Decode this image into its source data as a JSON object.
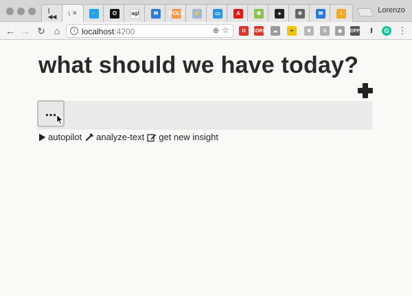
{
  "browser": {
    "profile_name": "Lorenzo",
    "active_tab": {
      "label": "\\",
      "close": "✕"
    },
    "tabs": [
      {
        "icon": "media-controls-icon",
        "glyph": "|◀◀",
        "color": "#e4e4e4"
      },
      {
        "icon": "twitter-icon",
        "glyph": "🐦",
        "color": "#1da1f2"
      },
      {
        "icon": "opera-o-icon",
        "glyph": "O",
        "color": "#111111"
      },
      {
        "icon": "agl-icon",
        "glyph": "agl",
        "color": "#ffffff"
      },
      {
        "icon": "inbox-icon",
        "glyph": "✉",
        "color": "#2b7bd6"
      },
      {
        "icon": "polls-icon",
        "glyph": "POLS",
        "color": "#f39a4b"
      },
      {
        "icon": "bolt-icon",
        "glyph": "⚡",
        "color": "#9fb8d8"
      },
      {
        "icon": "docker-icon",
        "glyph": "▭",
        "color": "#2496ed"
      },
      {
        "icon": "angular-icon",
        "glyph": "A",
        "color": "#dd1b16"
      },
      {
        "icon": "gear-green-icon",
        "glyph": "✱",
        "color": "#8bc34a"
      },
      {
        "icon": "github-icon",
        "glyph": "●",
        "color": "#222222"
      },
      {
        "icon": "atom-icon",
        "glyph": "⚛",
        "color": "#666666"
      },
      {
        "icon": "inbox-icon-2",
        "glyph": "✉",
        "color": "#2b7bd6"
      },
      {
        "icon": "info-orange-icon",
        "glyph": "i",
        "color": "#f5a623"
      }
    ],
    "toolbar": {
      "back_glyph": "←",
      "forward_glyph": "→",
      "reload_glyph": "↻",
      "home_glyph": "⌂",
      "url_host": "localhost",
      "url_port": ":4200",
      "info_glyph": "i",
      "zoom_glyph": "⊕",
      "star_glyph": "☆",
      "menu_glyph": "⋮",
      "extensions": [
        {
          "icon": "opera-red-icon",
          "text": "O",
          "color": "#e0342a"
        },
        {
          "icon": "cors-icon",
          "text": "CORS",
          "color": "#d9382b"
        },
        {
          "icon": "cloud-icon",
          "text": "☁",
          "color": "#9a9a9a"
        },
        {
          "icon": "yellow-face-icon",
          "text": "••",
          "color": "#f2c400"
        },
        {
          "icon": "leaf-icon",
          "text": "❦",
          "color": "#b8b8b8"
        },
        {
          "icon": "skype-icon",
          "text": "S",
          "color": "#b0b0b0"
        },
        {
          "icon": "camera-icon",
          "text": "◉",
          "color": "#a0a0a0"
        },
        {
          "icon": "off-icon",
          "text": "OFF",
          "color": "#555555"
        },
        {
          "icon": "cursor-i-icon",
          "text": "I",
          "color": "#f3f3f3"
        },
        {
          "icon": "grammarly-icon",
          "text": "G",
          "color": "#15c39a"
        }
      ]
    }
  },
  "page": {
    "title": "what should we have today?",
    "dots_label": "...",
    "actions": [
      {
        "icon": "play-icon",
        "label": "autopilot"
      },
      {
        "icon": "eyedropper-icon",
        "label": "analyze-text"
      },
      {
        "icon": "edit-icon",
        "label": "get new insight"
      }
    ]
  }
}
